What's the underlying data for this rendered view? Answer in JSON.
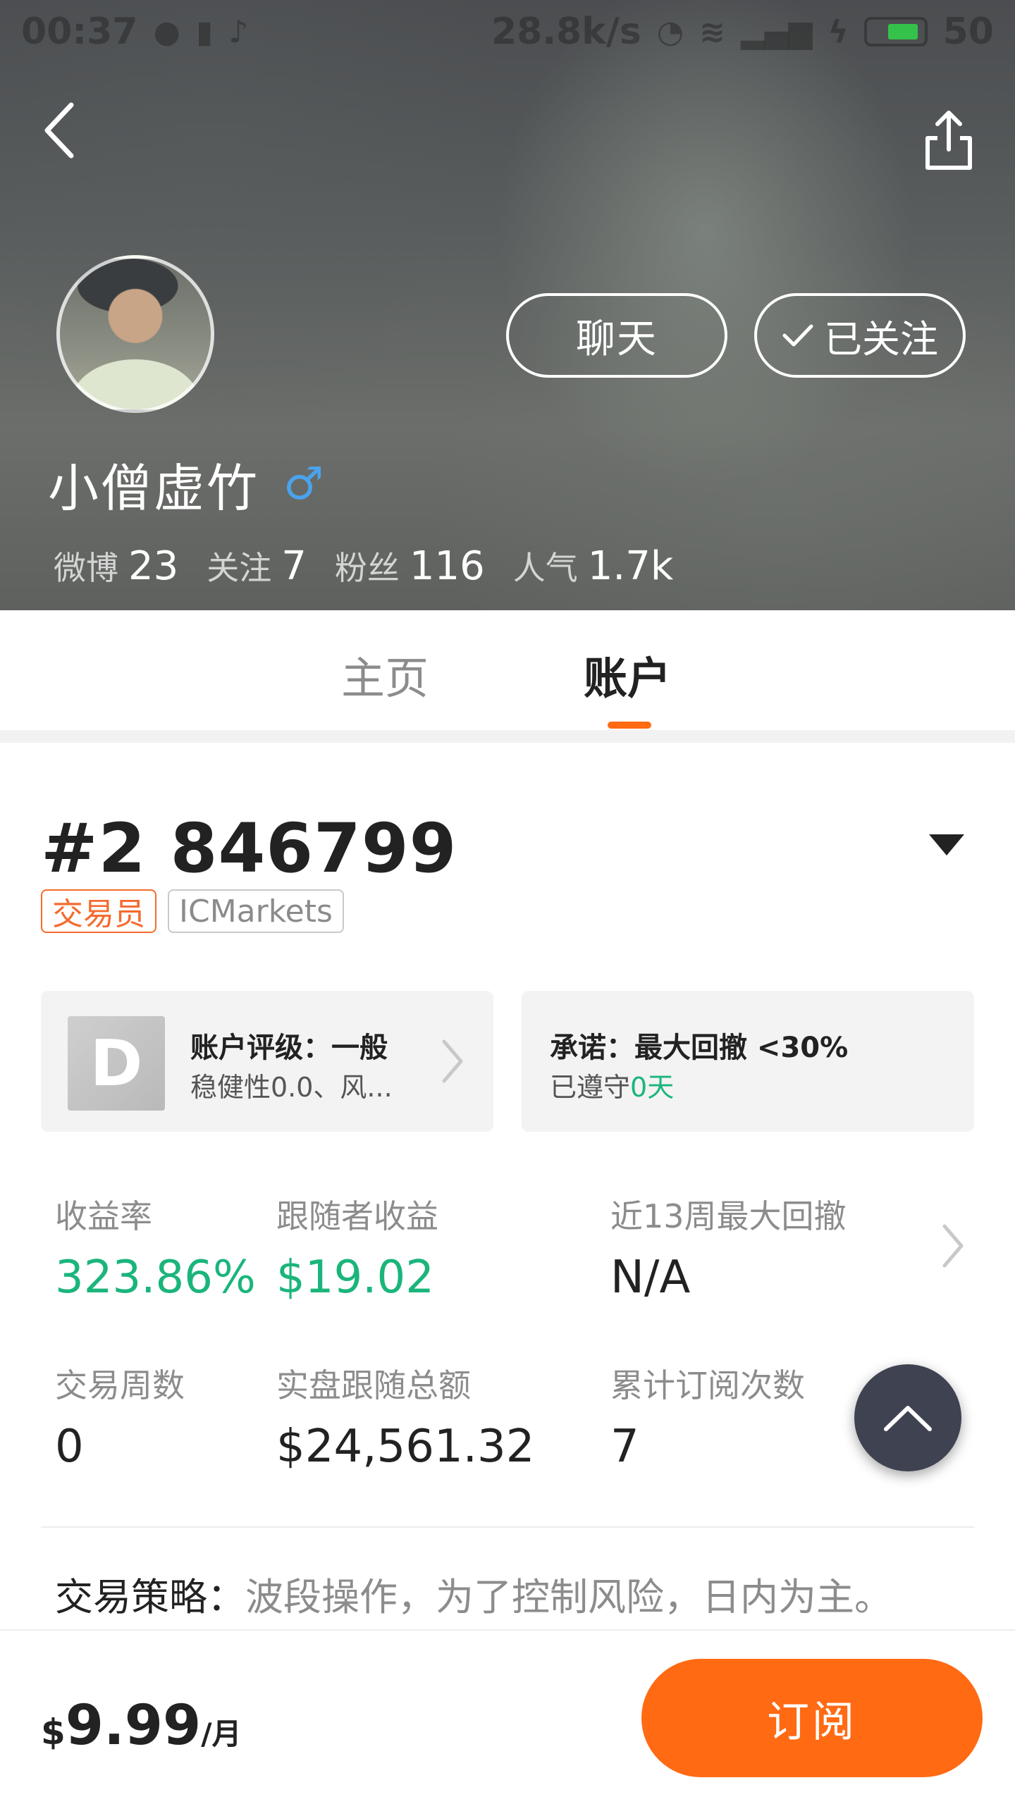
{
  "status_bar": {
    "time": "00:37",
    "speed": "28.8k/s",
    "battery": "50"
  },
  "header": {
    "username": "小僧虚竹",
    "gender_symbol": "♂",
    "chat_label": "聊天",
    "follow_label": "已关注",
    "stats": [
      {
        "label": "微博",
        "value": "23"
      },
      {
        "label": "关注",
        "value": "7"
      },
      {
        "label": "粉丝",
        "value": "116"
      },
      {
        "label": "人气",
        "value": "1.7k"
      }
    ]
  },
  "tabs": {
    "home": "主页",
    "account": "账户",
    "active": "account"
  },
  "account": {
    "number": "#2 846799",
    "tags": [
      "交易员",
      "ICMarkets"
    ],
    "rating_card": {
      "grade": "D",
      "title": "账户评级：一般",
      "subtitle": "稳健性0.0、风..."
    },
    "promise_card": {
      "title": "承诺：最大回撤 <30%",
      "subtitle_prefix": "已遵守",
      "subtitle_value": "0天"
    },
    "metrics": {
      "return_rate": {
        "label": "收益率",
        "value": "323.86%"
      },
      "follower_profit": {
        "label": "跟随者收益",
        "value": "$19.02"
      },
      "max_drawdown_13w": {
        "label": "近13周最大回撤",
        "value": "N/A"
      },
      "trading_weeks": {
        "label": "交易周数",
        "value": "0"
      },
      "live_follow_total": {
        "label": "实盘跟随总额",
        "value": "$24,561.32"
      },
      "total_subscriptions": {
        "label": "累计订阅次数",
        "value": "7"
      }
    },
    "strategy_label": "交易策略：",
    "strategy_text": "波段操作，为了控制风险，日内为主。"
  },
  "bottom_bar": {
    "price_currency": "$",
    "price_amount": "9.99",
    "price_unit": "/月",
    "subscribe_label": "订阅"
  },
  "colors": {
    "accent_orange": "#ff6a13",
    "positive_green": "#1bb57c",
    "gender_blue": "#4aa3ec"
  }
}
